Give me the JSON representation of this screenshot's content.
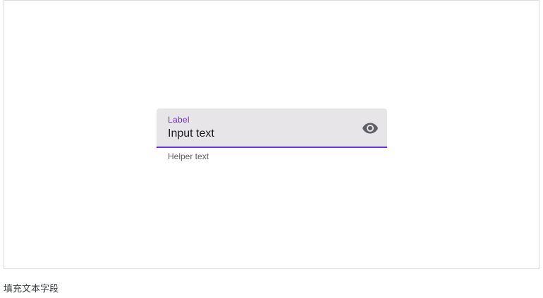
{
  "text_field": {
    "label": "Label",
    "value": "Input text",
    "helper_text": "Helper text",
    "trailing_icon": "visibility-eye-icon",
    "accent_color": "#6f2fe0",
    "container_color": "#e7e5e8"
  },
  "caption": "填充文本字段"
}
